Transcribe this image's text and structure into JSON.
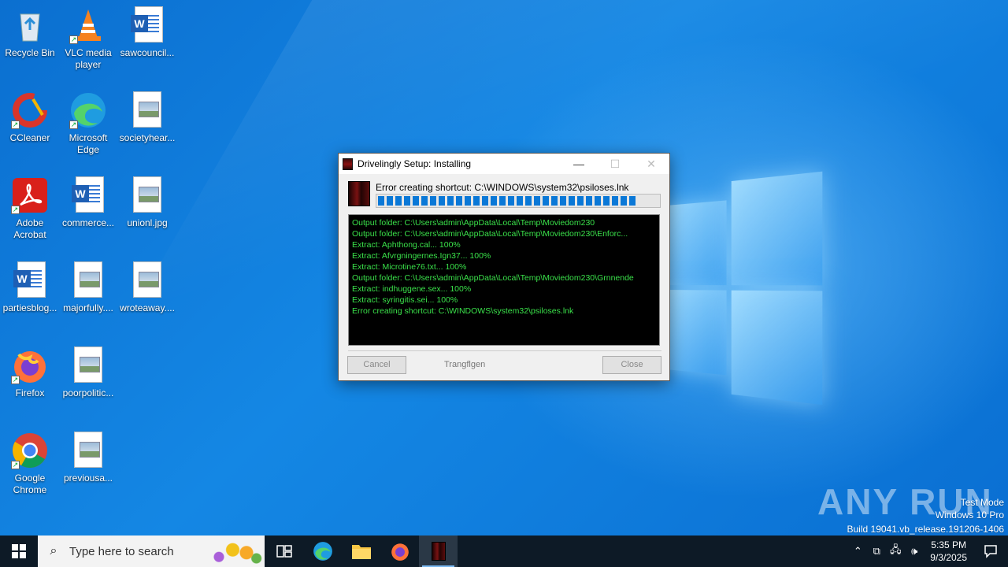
{
  "desktop": {
    "icons": [
      {
        "label": "Recycle Bin"
      },
      {
        "label": "VLC media player"
      },
      {
        "label": "sawcouncil..."
      },
      {
        "label": "CCleaner"
      },
      {
        "label": "Microsoft Edge"
      },
      {
        "label": "societyhear..."
      },
      {
        "label": "Adobe Acrobat"
      },
      {
        "label": "commerce..."
      },
      {
        "label": "unionl.jpg"
      },
      {
        "label": "partiesblog..."
      },
      {
        "label": "majorfully...."
      },
      {
        "label": "wroteaway...."
      },
      {
        "label": "Firefox"
      },
      {
        "label": "poorpolitic..."
      },
      {
        "label": "Google Chrome"
      },
      {
        "label": "previousa..."
      }
    ]
  },
  "dialog": {
    "title": "Drivelingly Setup: Installing",
    "status": "Error creating shortcut: C:\\WINDOWS\\system32\\psiloses.lnk",
    "progress_fraction": 0.92,
    "log": [
      "Output folder: C:\\Users\\admin\\AppData\\Local\\Temp\\Moviedom230",
      "Output folder: C:\\Users\\admin\\AppData\\Local\\Temp\\Moviedom230\\Enforc...",
      "Extract: Aphthong.cal... 100%",
      "Extract: Afvrgningernes.Ign37... 100%",
      "Extract: Microtine76.txt... 100%",
      "Output folder: C:\\Users\\admin\\AppData\\Local\\Temp\\Moviedom230\\Grnnende",
      "Extract: indhuggene.sex... 100%",
      "Extract: syringitis.sei... 100%",
      "Error creating shortcut: C:\\WINDOWS\\system32\\psiloses.lnk"
    ],
    "cancel_label": "Cancel",
    "branding": "Trangflgen",
    "close_label": "Close"
  },
  "watermark": {
    "brand": "ANY RUN",
    "line1": "Test Mode",
    "line2": "Windows 10 Pro",
    "line3": "Build 19041.vb_release.191206-1406"
  },
  "taskbar": {
    "search_placeholder": "Type here to search",
    "time": "5:35 PM",
    "date": "9/3/2025"
  }
}
